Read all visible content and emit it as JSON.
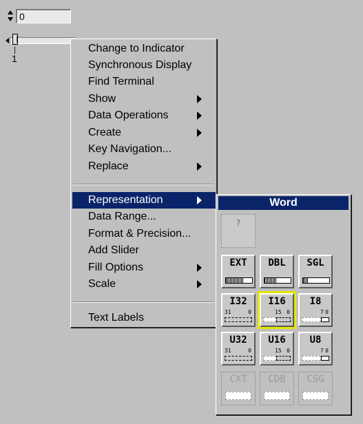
{
  "numeric_control": {
    "value": "0"
  },
  "slider": {
    "scale_label": "1"
  },
  "context_menu": {
    "items": [
      {
        "label": "Change to Indicator",
        "submenu": false
      },
      {
        "label": "Synchronous Display",
        "submenu": false
      },
      {
        "label": "Find Terminal",
        "submenu": false
      },
      {
        "label": "Show",
        "submenu": true
      },
      {
        "label": "Data Operations",
        "submenu": true
      },
      {
        "label": "Create",
        "submenu": true
      },
      {
        "label": "Key Navigation...",
        "submenu": false
      },
      {
        "label": "Replace",
        "submenu": true
      },
      {
        "label": "Representation",
        "submenu": true,
        "highlighted": true
      },
      {
        "label": "Data Range...",
        "submenu": false
      },
      {
        "label": "Format & Precision...",
        "submenu": false
      },
      {
        "label": "Add Slider",
        "submenu": false
      },
      {
        "label": "Fill Options",
        "submenu": true
      },
      {
        "label": "Scale",
        "submenu": true
      },
      {
        "label": "Text Labels",
        "submenu": false
      }
    ]
  },
  "representation_palette": {
    "title": "Word",
    "unknown_label": "?",
    "types": [
      {
        "label": "EXT"
      },
      {
        "label": "DBL"
      },
      {
        "label": "SGL"
      },
      {
        "label": "I32",
        "bits_left": "31",
        "bits_right": "0"
      },
      {
        "label": "I16",
        "bits_left": "15",
        "bits_right": "0",
        "selected": true
      },
      {
        "label": "I8",
        "bits_left": "7",
        "bits_right": "0"
      },
      {
        "label": "U32",
        "bits_left": "31",
        "bits_right": "0"
      },
      {
        "label": "U16",
        "bits_left": "15",
        "bits_right": "0"
      },
      {
        "label": "U8",
        "bits_left": "7",
        "bits_right": "0"
      },
      {
        "label": "CXT",
        "disabled": true
      },
      {
        "label": "CDB",
        "disabled": true
      },
      {
        "label": "CSG",
        "disabled": true
      }
    ]
  },
  "colors": {
    "background": "#c0c0c0",
    "menu_highlight": "#0a246a",
    "selection_outline": "#e6e600"
  }
}
